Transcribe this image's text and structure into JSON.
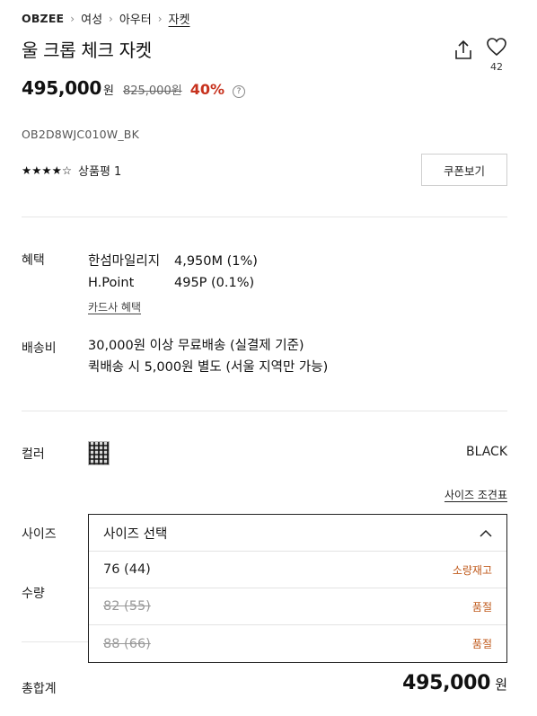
{
  "breadcrumb": {
    "brand": "OBZEE",
    "items": [
      "여성",
      "아우터",
      "자켓"
    ]
  },
  "product": {
    "title": "울 크롭 체크 자켓",
    "like_count": "42",
    "price": "495,000",
    "currency": "원",
    "original_price": "825,000원",
    "discount": "40%",
    "sku": "OB2D8WJC010W_BK",
    "rating_stars": "★★★★☆",
    "rating": 4,
    "review_label": "상품평 1",
    "coupon_button": "쿠폰보기"
  },
  "benefits": {
    "label": "혜택",
    "rows": [
      {
        "name": "한섬마일리지",
        "value": "4,950M (1%)"
      },
      {
        "name": "H.Point",
        "value": "495P (0.1%)"
      }
    ],
    "card_link": "카드사 혜택"
  },
  "shipping": {
    "label": "배송비",
    "lines": [
      "30,000원 이상 무료배송 (실결제 기준)",
      "퀵배송 시 5,000원 별도 (서울 지역만 가능)"
    ]
  },
  "color": {
    "label": "컬러",
    "value": "BLACK"
  },
  "size_chart_link": "사이즈 조견표",
  "size": {
    "label": "사이즈",
    "placeholder": "사이즈 선택",
    "options": [
      {
        "value": "76 (44)",
        "status": "소량재고",
        "sold_out": false
      },
      {
        "value": "82 (55)",
        "status": "품절",
        "sold_out": true
      },
      {
        "value": "88 (66)",
        "status": "품절",
        "sold_out": true
      }
    ]
  },
  "quantity": {
    "label": "수량"
  },
  "total": {
    "label": "총합계",
    "price": "495,000",
    "currency": "원"
  },
  "colors": {
    "discount": "#c7321e",
    "stock_status": "#c05a1c"
  }
}
